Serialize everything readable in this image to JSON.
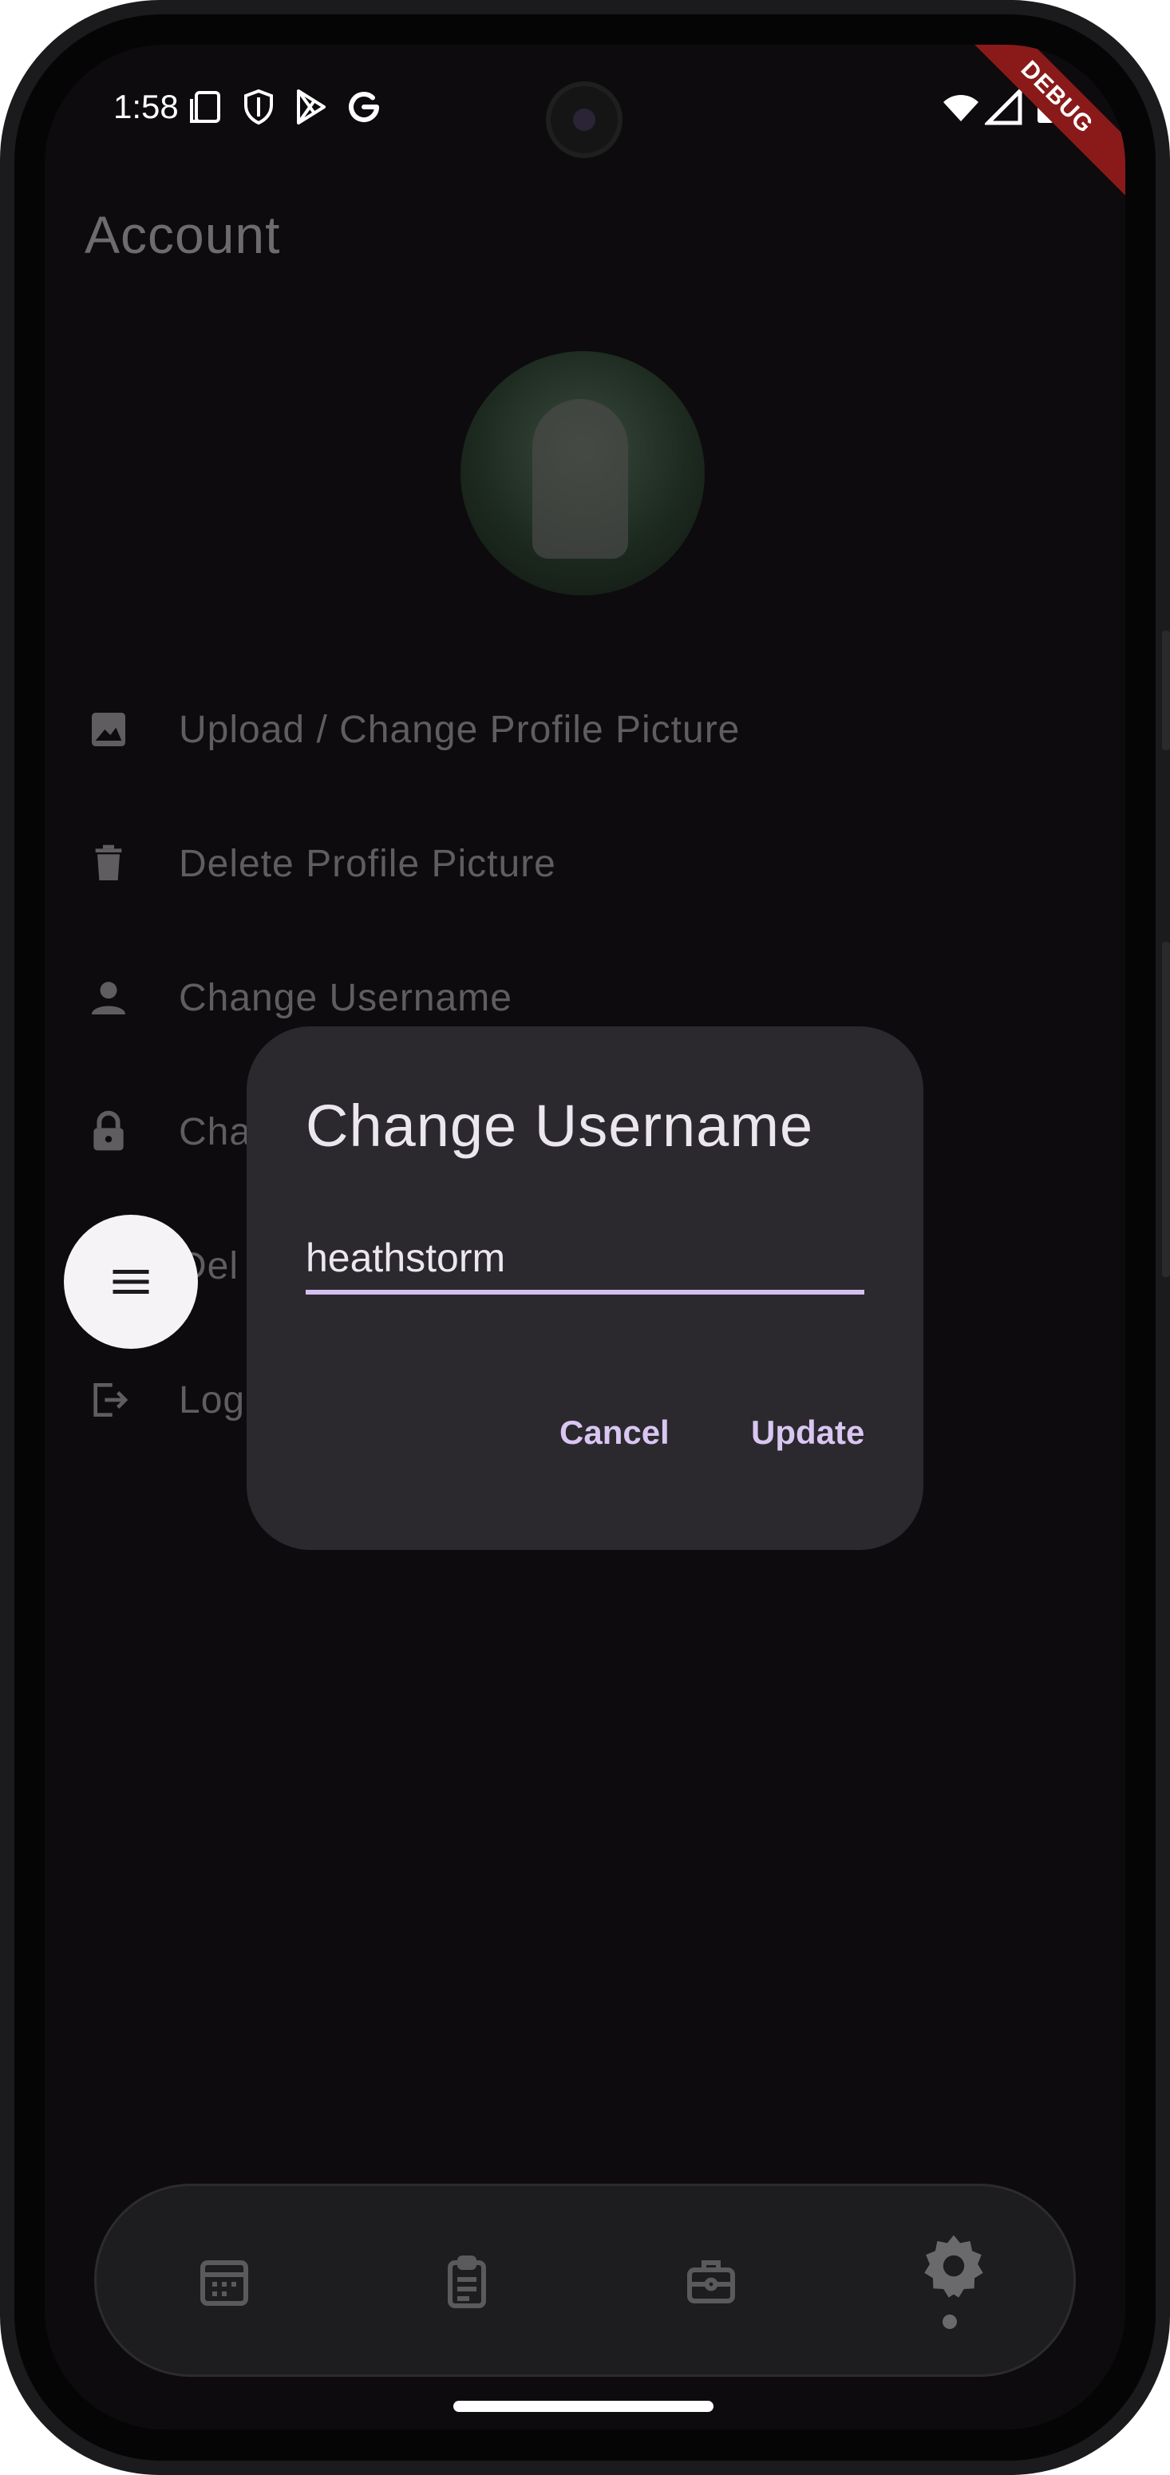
{
  "status_bar": {
    "time": "1:58",
    "debug_label": "DEBUG"
  },
  "page": {
    "title": "Account"
  },
  "menu": {
    "items": [
      {
        "label": "Upload / Change Profile Picture",
        "icon": "image-icon"
      },
      {
        "label": "Delete Profile Picture",
        "icon": "trash-icon"
      },
      {
        "label": "Change Username",
        "icon": "person-icon"
      },
      {
        "label": "Cha",
        "icon": "lock-icon"
      },
      {
        "label": "Del",
        "icon": "trash-icon"
      },
      {
        "label": "Log",
        "icon": "logout-icon"
      }
    ]
  },
  "dialog": {
    "title": "Change Username",
    "input_value": "heathstorm",
    "cancel_label": "Cancel",
    "update_label": "Update"
  },
  "nav": {
    "items": [
      {
        "name": "calendar-icon"
      },
      {
        "name": "clipboard-icon"
      },
      {
        "name": "briefcase-icon"
      },
      {
        "name": "settings-icon",
        "selected": true
      }
    ]
  },
  "colors": {
    "background": "#0d0b0e",
    "dialog_bg": "#2b292d",
    "accent": "#d4bff0",
    "fab_bg": "#f6f3f7"
  }
}
